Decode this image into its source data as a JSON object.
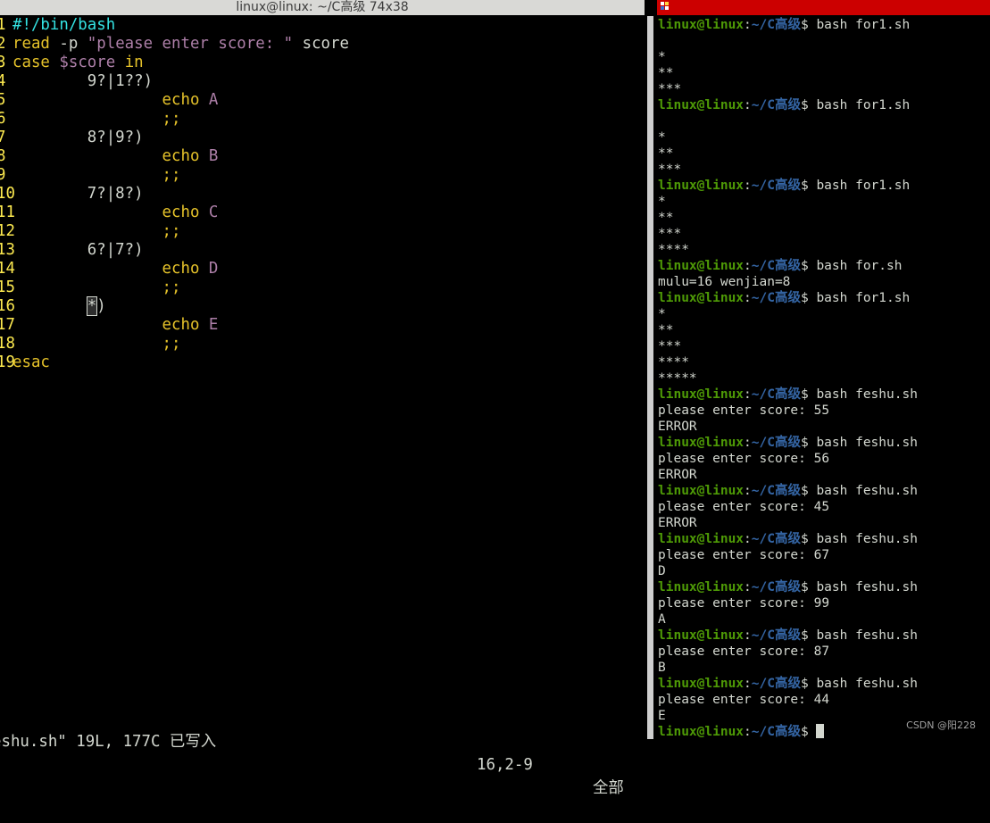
{
  "left_window": {
    "title": "linux@linux: ~/C高级 74x38",
    "lines": [
      {
        "num": "1",
        "indent": "",
        "parts": [
          {
            "t": "#!/bin/bash",
            "c": "c-cyan"
          }
        ]
      },
      {
        "num": "2",
        "indent": "",
        "parts": [
          {
            "t": "read",
            "c": "c-yellow"
          },
          {
            "t": " -p ",
            "c": "c-white"
          },
          {
            "t": "\"please enter score: \"",
            "c": "c-purple"
          },
          {
            "t": " score",
            "c": "c-white"
          }
        ]
      },
      {
        "num": "3",
        "indent": "",
        "parts": [
          {
            "t": "case",
            "c": "c-yellow"
          },
          {
            "t": " ",
            "c": "c-white"
          },
          {
            "t": "$score",
            "c": "c-purple"
          },
          {
            "t": " ",
            "c": "c-white"
          },
          {
            "t": "in",
            "c": "c-yellow"
          }
        ]
      },
      {
        "num": "4",
        "indent": "        ",
        "parts": [
          {
            "t": "9?|1??)",
            "c": "c-white"
          }
        ]
      },
      {
        "num": "5",
        "indent": "                ",
        "parts": [
          {
            "t": "echo",
            "c": "c-yellow"
          },
          {
            "t": " ",
            "c": "c-white"
          },
          {
            "t": "A",
            "c": "c-purple"
          }
        ]
      },
      {
        "num": "6",
        "indent": "                ",
        "parts": [
          {
            "t": ";;",
            "c": "c-yellow"
          }
        ]
      },
      {
        "num": "7",
        "indent": "        ",
        "parts": [
          {
            "t": "8?|9?)",
            "c": "c-white"
          }
        ]
      },
      {
        "num": "8",
        "indent": "                ",
        "parts": [
          {
            "t": "echo",
            "c": "c-yellow"
          },
          {
            "t": " ",
            "c": "c-white"
          },
          {
            "t": "B",
            "c": "c-purple"
          }
        ]
      },
      {
        "num": "9",
        "indent": "                ",
        "parts": [
          {
            "t": ";;",
            "c": "c-yellow"
          }
        ]
      },
      {
        "num": "10",
        "indent": "        ",
        "parts": [
          {
            "t": "7?|8?)",
            "c": "c-white"
          }
        ]
      },
      {
        "num": "11",
        "indent": "                ",
        "parts": [
          {
            "t": "echo",
            "c": "c-yellow"
          },
          {
            "t": " ",
            "c": "c-white"
          },
          {
            "t": "C",
            "c": "c-purple"
          }
        ]
      },
      {
        "num": "12",
        "indent": "                ",
        "parts": [
          {
            "t": ";;",
            "c": "c-yellow"
          }
        ]
      },
      {
        "num": "13",
        "indent": "        ",
        "parts": [
          {
            "t": "6?|7?)",
            "c": "c-white"
          }
        ]
      },
      {
        "num": "14",
        "indent": "                ",
        "parts": [
          {
            "t": "echo",
            "c": "c-yellow"
          },
          {
            "t": " ",
            "c": "c-white"
          },
          {
            "t": "D",
            "c": "c-purple"
          }
        ]
      },
      {
        "num": "15",
        "indent": "                ",
        "parts": [
          {
            "t": ";;",
            "c": "c-yellow"
          }
        ]
      },
      {
        "num": "16",
        "indent": "        ",
        "parts": [
          {
            "t": "*",
            "c": "c-white",
            "cursor": true
          },
          {
            "t": ")",
            "c": "c-white"
          }
        ]
      },
      {
        "num": "17",
        "indent": "                ",
        "parts": [
          {
            "t": "echo",
            "c": "c-yellow"
          },
          {
            "t": " ",
            "c": "c-white"
          },
          {
            "t": "E",
            "c": "c-purple"
          }
        ]
      },
      {
        "num": "18",
        "indent": "                ",
        "parts": [
          {
            "t": ";;",
            "c": "c-yellow"
          }
        ]
      },
      {
        "num": "19",
        "indent": "",
        "parts": [
          {
            "t": "esac",
            "c": "c-yellow"
          }
        ]
      }
    ],
    "status": {
      "message": "eshu.sh\" 19L, 177C 已写入",
      "position": "16,2-9",
      "percent": "全部"
    }
  },
  "right_window": {
    "prompt": {
      "user": "linux@linux",
      "colon": ":",
      "path": "~/C高级",
      "dollar": "$ "
    },
    "lines": [
      {
        "type": "prompt",
        "cmd": "bash for1.sh"
      },
      {
        "type": "out",
        "text": ""
      },
      {
        "type": "out",
        "text": "*"
      },
      {
        "type": "out",
        "text": "**"
      },
      {
        "type": "out",
        "text": "***"
      },
      {
        "type": "prompt",
        "cmd": "bash for1.sh"
      },
      {
        "type": "out",
        "text": ""
      },
      {
        "type": "out",
        "text": "*"
      },
      {
        "type": "out",
        "text": "**"
      },
      {
        "type": "out",
        "text": "***"
      },
      {
        "type": "prompt",
        "cmd": "bash for1.sh"
      },
      {
        "type": "out",
        "text": "*"
      },
      {
        "type": "out",
        "text": "**"
      },
      {
        "type": "out",
        "text": "***"
      },
      {
        "type": "out",
        "text": "****"
      },
      {
        "type": "prompt",
        "cmd": "bash for.sh"
      },
      {
        "type": "out",
        "text": "mulu=16 wenjian=8"
      },
      {
        "type": "prompt",
        "cmd": "bash for1.sh"
      },
      {
        "type": "out",
        "text": "*"
      },
      {
        "type": "out",
        "text": "**"
      },
      {
        "type": "out",
        "text": "***"
      },
      {
        "type": "out",
        "text": "****"
      },
      {
        "type": "out",
        "text": "*****"
      },
      {
        "type": "prompt",
        "cmd": "bash feshu.sh"
      },
      {
        "type": "out",
        "text": "please enter score: 55"
      },
      {
        "type": "out",
        "text": "ERROR"
      },
      {
        "type": "prompt",
        "cmd": "bash feshu.sh"
      },
      {
        "type": "out",
        "text": "please enter score: 56"
      },
      {
        "type": "out",
        "text": "ERROR"
      },
      {
        "type": "prompt",
        "cmd": "bash feshu.sh"
      },
      {
        "type": "out",
        "text": "please enter score: 45"
      },
      {
        "type": "out",
        "text": "ERROR"
      },
      {
        "type": "prompt",
        "cmd": "bash feshu.sh"
      },
      {
        "type": "out",
        "text": "please enter score: 67"
      },
      {
        "type": "out",
        "text": "D"
      },
      {
        "type": "prompt",
        "cmd": "bash feshu.sh"
      },
      {
        "type": "out",
        "text": "please enter score: 99"
      },
      {
        "type": "out",
        "text": "A"
      },
      {
        "type": "prompt",
        "cmd": "bash feshu.sh"
      },
      {
        "type": "out",
        "text": "please enter score: 87"
      },
      {
        "type": "out",
        "text": "B"
      },
      {
        "type": "prompt",
        "cmd": "bash feshu.sh"
      },
      {
        "type": "out",
        "text": "please enter score: 44"
      },
      {
        "type": "out",
        "text": "E"
      },
      {
        "type": "prompt",
        "cmd": "",
        "cursor": true
      }
    ],
    "watermark": "CSDN @阳228"
  },
  "colors": {
    "left_titlebar": "#d9d9d6",
    "right_titlebar": "#cc0000",
    "prompt_user": "#4e9a06",
    "prompt_path": "#3465a4",
    "vim_keyword": "#e5c22a",
    "vim_string": "#ad7fa8",
    "vim_comment": "#34e2e2"
  }
}
